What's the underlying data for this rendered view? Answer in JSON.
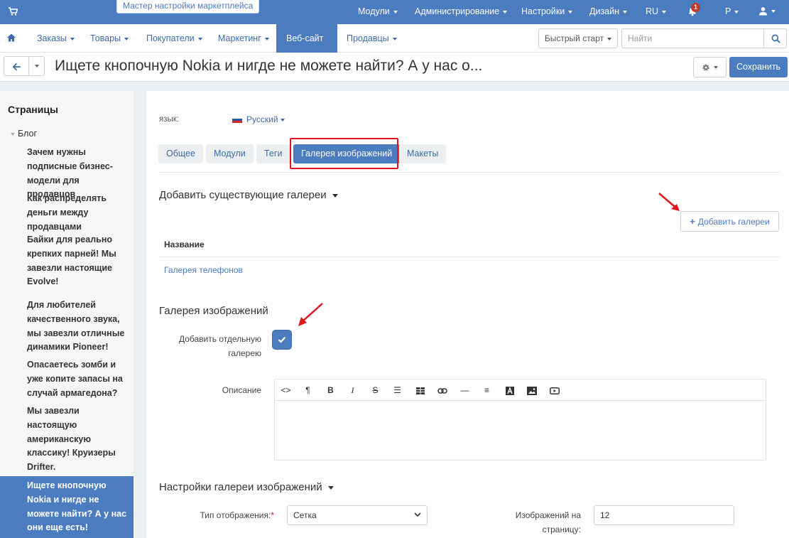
{
  "topbar": {
    "wizard_label": "Мастер настройки маркетплейса",
    "menu": [
      {
        "label": "Модули"
      },
      {
        "label": "Администрирование"
      },
      {
        "label": "Настройки"
      },
      {
        "label": "Дизайн"
      },
      {
        "label": "RU"
      },
      {
        "label": "Р"
      }
    ],
    "notifications_count": "1"
  },
  "nav": {
    "items": [
      {
        "label": "Заказы"
      },
      {
        "label": "Товары"
      },
      {
        "label": "Покупатели"
      },
      {
        "label": "Маркетинг"
      },
      {
        "label": "Веб-сайт"
      },
      {
        "label": "Продавцы"
      }
    ],
    "active_item": "Веб-сайт",
    "quick_start_label": "Быстрый старт",
    "search_placeholder": "Найти"
  },
  "header": {
    "title": "Ищете кнопочную Nokia и нигде не можете найти? А у нас о...",
    "save_label": "Сохранить"
  },
  "sidebar": {
    "title": "Страницы",
    "group_label": "Блог",
    "items": [
      {
        "label": "Зачем нужны подписные бизнес-модели для продавцов"
      },
      {
        "label": "Как распределять деньги между продавцами"
      },
      {
        "label": "Байки для реально крепких парней! Мы завезли настоящие Evolve!"
      },
      {
        "label": "Для любителей качественного звука, мы завезли отличные динамики Pioneer!"
      },
      {
        "label": "Опасаетесь зомби и уже копите запасы на случай армагедона?"
      },
      {
        "label": "Мы завезли настоящую американскую классику! Круизеры Drifter."
      },
      {
        "label": "Ищете кнопочную Nokia и нигде не можете найти? А у нас они еще есть!"
      }
    ],
    "active_index": 6
  },
  "content": {
    "language_label": "язык:",
    "language_value": "Русский",
    "tabs": [
      {
        "label": "Общее"
      },
      {
        "label": "Модули"
      },
      {
        "label": "Теги"
      },
      {
        "label": "Галерея изображений"
      },
      {
        "label": "Макеты"
      }
    ],
    "active_tab": "Галерея изображений",
    "existing_galleries": {
      "title": "Добавить существующие галереи",
      "add_button_label": "Добавить галереи",
      "column_header": "Название",
      "rows": [
        {
          "name": "Галерея телефонов"
        }
      ]
    },
    "gallery": {
      "title": "Галерея изображений",
      "add_separate_label": "Добавить отдельную галерею",
      "add_separate_checked": true,
      "description_label": "Описание",
      "toolbar_icons": [
        "code-icon",
        "paragraph-icon",
        "bold-icon",
        "italic-icon",
        "strikethrough-icon",
        "unordered-list-icon",
        "table-icon",
        "link-icon",
        "horizontal-rule-icon",
        "align-icon",
        "font-color-icon",
        "image-icon",
        "video-icon"
      ]
    },
    "settings": {
      "title": "Настройки галереи изображений",
      "display_type_label": "Тип отображения:",
      "display_type_value": "Сетка",
      "per_page_label": "Изображений на страницу:",
      "per_page_value": "12"
    }
  },
  "colors": {
    "brand": "#4a7cbf",
    "highlight": "#e0141c"
  }
}
